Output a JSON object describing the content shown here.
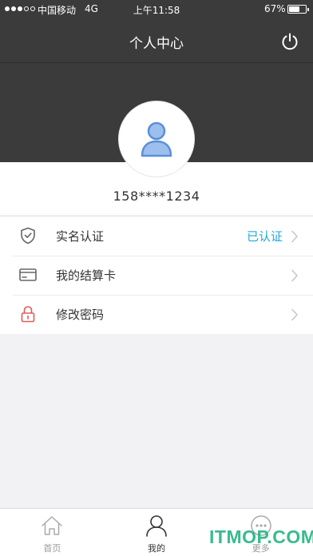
{
  "status_bar": {
    "carrier": "中国移动",
    "network": "4G",
    "time": "上午11:58",
    "battery": "67%",
    "battery_level": 0.67,
    "signal_bars_filled": 3,
    "signal_bars_total": 5
  },
  "header": {
    "title": "个人中心",
    "power_icon": "power-icon"
  },
  "profile": {
    "avatar_icon": "user-avatar-icon",
    "phone": "158****1234"
  },
  "menu": [
    {
      "icon": "shield-check-icon",
      "label": "实名认证",
      "value": "已认证"
    },
    {
      "icon": "bank-card-icon",
      "label": "我的结算卡",
      "value": ""
    },
    {
      "icon": "lock-icon",
      "label": "修改密码",
      "value": ""
    }
  ],
  "tab_bar": [
    {
      "icon": "home-icon",
      "label": "首页",
      "active": false
    },
    {
      "icon": "person-icon",
      "label": "我的",
      "active": true
    },
    {
      "icon": "more-icon",
      "label": "更多",
      "active": false
    }
  ],
  "watermark": "ITMOP.COM",
  "colors": {
    "header_bg": "#3b3b3b",
    "accent_blue": "#1ea8e0",
    "lock_red": "#e05a5a",
    "avatar_blue": "#5b8fd9",
    "watermark_green": "#2eb88a",
    "page_bg": "#f2f2f4"
  }
}
